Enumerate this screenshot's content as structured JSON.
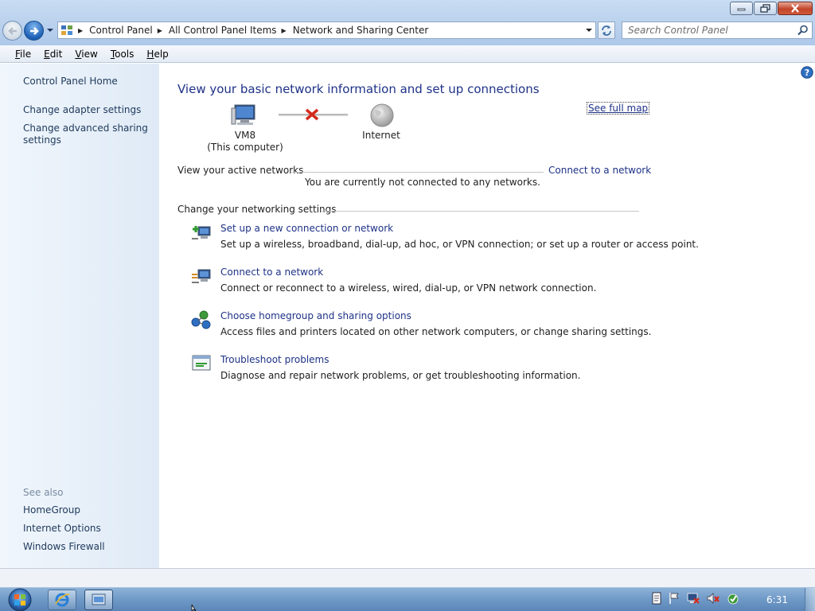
{
  "window": {
    "minimize_label": "Minimize",
    "maximize_label": "Restore",
    "close_label": "Close"
  },
  "address": {
    "crumbs": [
      "Control Panel",
      "All Control Panel Items",
      "Network and Sharing Center"
    ]
  },
  "search": {
    "placeholder": "Search Control Panel"
  },
  "menu": {
    "items": [
      {
        "first": "F",
        "rest": "ile"
      },
      {
        "first": "E",
        "rest": "dit"
      },
      {
        "first": "V",
        "rest": "iew"
      },
      {
        "first": "T",
        "rest": "ools"
      },
      {
        "first": "H",
        "rest": "elp"
      }
    ]
  },
  "sidebar": {
    "home": "Control Panel Home",
    "adapter": "Change adapter settings",
    "advanced_line1": "Change advanced sharing",
    "advanced_line2": "settings",
    "see_also": "See also",
    "links": [
      "HomeGroup",
      "Internet Options",
      "Windows Firewall"
    ]
  },
  "main": {
    "title": "View your basic network information and set up connections",
    "see_full_map": "See full map",
    "map": {
      "computer_name": "VM8",
      "computer_sub": "(This computer)",
      "internet": "Internet"
    },
    "active_heading": "View your active networks",
    "connect_link": "Connect to a network",
    "not_connected": "You are currently not connected to any networks.",
    "change_heading": "Change your networking settings",
    "tasks": [
      {
        "link": "Set up a new connection or network",
        "desc": "Set up a wireless, broadband, dial-up, ad hoc, or VPN connection; or set up a router or access point.",
        "icon": "new-connection-icon"
      },
      {
        "link": "Connect to a network",
        "desc": "Connect or reconnect to a wireless, wired, dial-up, or VPN network connection.",
        "icon": "connect-network-icon"
      },
      {
        "link": "Choose homegroup and sharing options",
        "desc": "Access files and printers located on other network computers, or change sharing settings.",
        "icon": "homegroup-icon"
      },
      {
        "link": "Troubleshoot problems",
        "desc": "Diagnose and repair network problems, or get troubleshooting information.",
        "icon": "troubleshoot-icon"
      }
    ]
  },
  "taskbar": {
    "clock": "6:31"
  },
  "colors": {
    "link": "#1e3287",
    "sidebar_link": "#1e395b",
    "title": "#1e3287",
    "disconnect": "#d42a1c"
  }
}
